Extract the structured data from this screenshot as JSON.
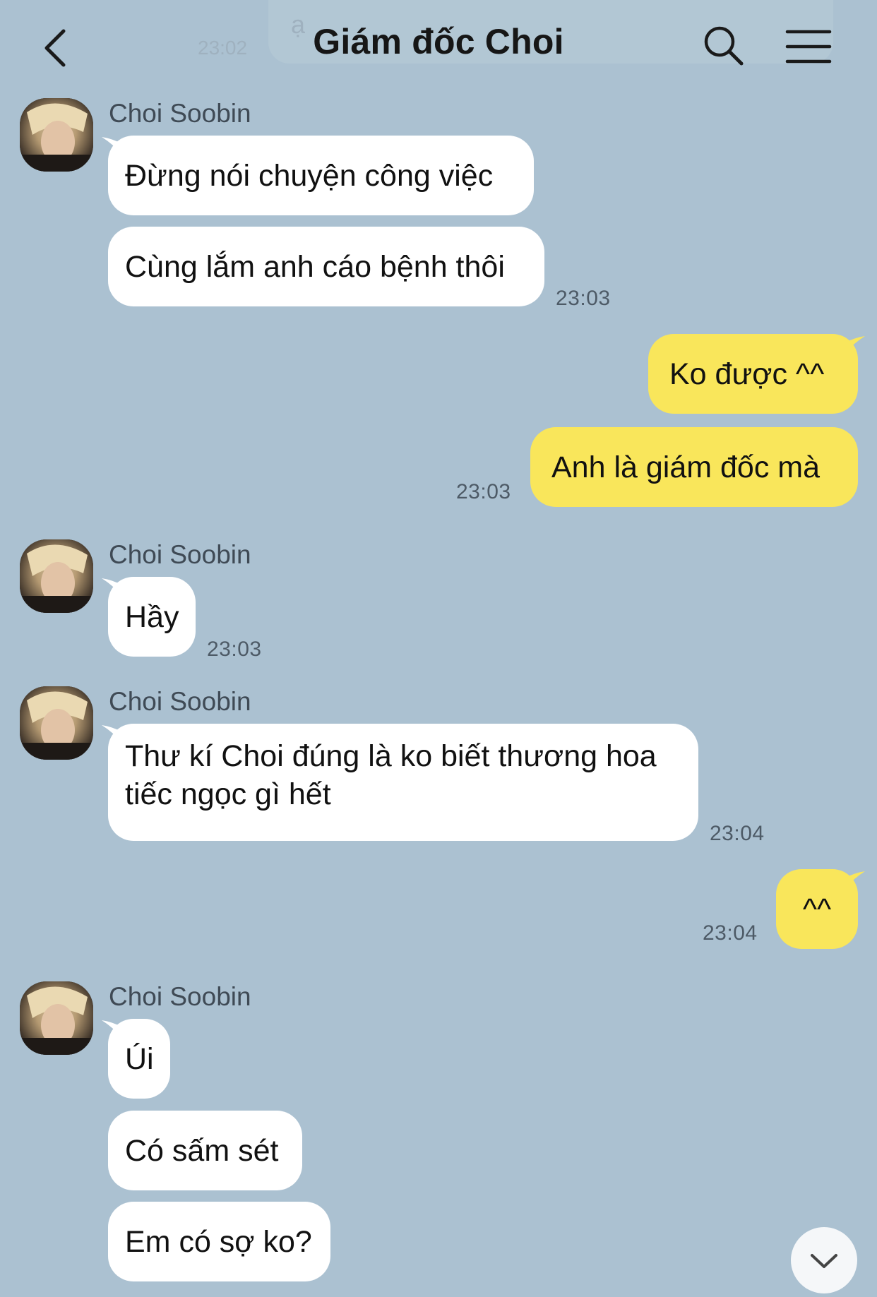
{
  "header": {
    "title": "Giám đốc Choi",
    "ghost_time": "23:02",
    "ghost_text": "ạ"
  },
  "colors": {
    "background": "#abc1d1",
    "incoming": "#ffffff",
    "outgoing": "#f9e65b"
  },
  "messages": {
    "g1": {
      "sender": "Choi Soobin",
      "m1": "Đừng nói chuyện công việc",
      "m2": "Cùng lắm anh cáo bệnh thôi",
      "time": "23:03"
    },
    "g2": {
      "m1": "Ko được ^^",
      "m2": "Anh là giám đốc mà",
      "time": "23:03"
    },
    "g3": {
      "sender": "Choi Soobin",
      "m1": "Hầy",
      "time": "23:03"
    },
    "g4": {
      "sender": "Choi Soobin",
      "m1_line1": "Thư kí Choi đúng là ko biết thương hoa",
      "m1_line2": "tiếc ngọc gì hết",
      "time": "23:04"
    },
    "g5": {
      "m1": "^^",
      "time": "23:04"
    },
    "g6": {
      "sender": "Choi Soobin",
      "m1": "Úi",
      "m2": "Có sấm sét",
      "m3": "Em có sợ ko?"
    }
  },
  "icons": [
    "back-arrow-icon",
    "search-icon",
    "menu-icon",
    "scroll-down-icon"
  ]
}
